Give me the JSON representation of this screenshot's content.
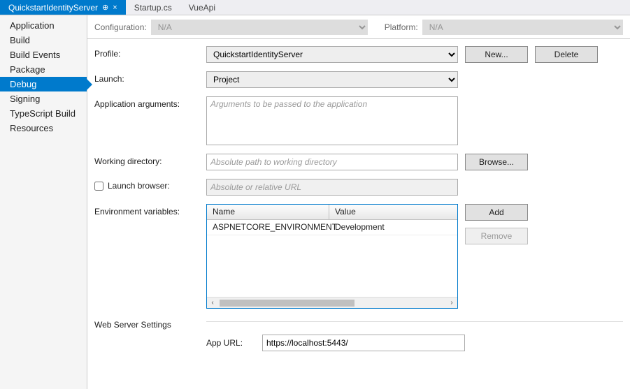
{
  "tabs": [
    {
      "label": "QuickstartIdentityServer",
      "active": true,
      "pinned": true,
      "closable": true
    },
    {
      "label": "Startup.cs",
      "active": false
    },
    {
      "label": "VueApi",
      "active": false
    }
  ],
  "sidebar": {
    "items": [
      {
        "label": "Application",
        "selected": false
      },
      {
        "label": "Build",
        "selected": false
      },
      {
        "label": "Build Events",
        "selected": false
      },
      {
        "label": "Package",
        "selected": false
      },
      {
        "label": "Debug",
        "selected": true
      },
      {
        "label": "Signing",
        "selected": false
      },
      {
        "label": "TypeScript Build",
        "selected": false
      },
      {
        "label": "Resources",
        "selected": false
      }
    ]
  },
  "topbar": {
    "config_label": "Configuration:",
    "config_value": "N/A",
    "platform_label": "Platform:",
    "platform_value": "N/A"
  },
  "form": {
    "profile_label": "Profile:",
    "profile_value": "QuickstartIdentityServer",
    "new_btn": "New...",
    "delete_btn": "Delete",
    "launch_label": "Launch:",
    "launch_value": "Project",
    "appargs_label": "Application arguments:",
    "appargs_placeholder": "Arguments to be passed to the application",
    "workdir_label": "Working directory:",
    "workdir_placeholder": "Absolute path to working directory",
    "browse_btn": "Browse...",
    "launch_browser_label": "Launch browser:",
    "launch_browser_placeholder": "Absolute or relative URL",
    "envvars_label": "Environment variables:",
    "env_col_name": "Name",
    "env_col_value": "Value",
    "env_rows": [
      {
        "name": "ASPNETCORE_ENVIRONMENT",
        "value": "Development"
      }
    ],
    "add_btn": "Add",
    "remove_btn": "Remove",
    "webserver_label": "Web Server Settings",
    "appurl_label": "App URL:",
    "appurl_value": "https://localhost:5443/"
  }
}
